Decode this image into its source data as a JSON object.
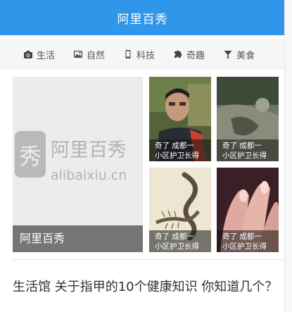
{
  "header": {
    "title": "阿里百秀"
  },
  "nav": {
    "items": [
      {
        "icon": "camera-icon",
        "label": "生活"
      },
      {
        "icon": "image-icon",
        "label": "自然"
      },
      {
        "icon": "phone-icon",
        "label": "科技"
      },
      {
        "icon": "puzzle-icon",
        "label": "奇趣"
      },
      {
        "icon": "cocktail-icon",
        "label": "美食"
      }
    ]
  },
  "featured": {
    "main": {
      "logo_text": "阿里百秀",
      "logo_url_text": "alibaixiu.cn",
      "logo_mark": "秀",
      "caption": "阿里百秀"
    },
    "tiles": [
      {
        "caption_line1": "奇了 成都一",
        "caption_line2": "小区护卫长得"
      },
      {
        "caption_line1": "奇了 成都一",
        "caption_line2": "小区护卫长得"
      },
      {
        "caption_line1": "奇了 成都一",
        "caption_line2": "小区护卫长得"
      },
      {
        "caption_line1": "奇了 成都一",
        "caption_line2": "小区护卫长得"
      }
    ]
  },
  "article": {
    "title": "生活馆 关于指甲的10个健康知识 你知道几个？"
  }
}
